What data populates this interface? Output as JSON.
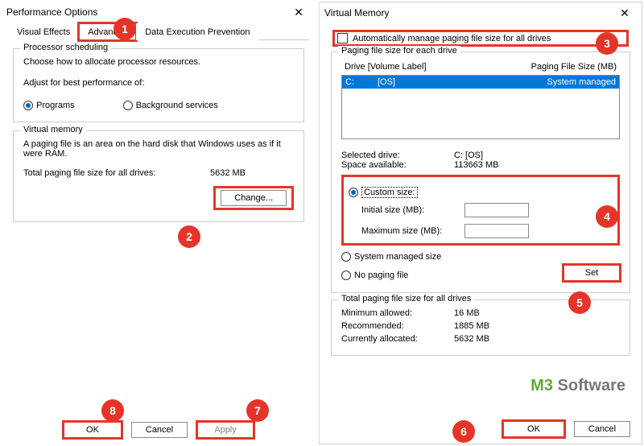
{
  "left": {
    "title": "Performance Options",
    "tabs": {
      "visual": "Visual Effects",
      "advanced": "Advanced",
      "dep": "Data Execution Prevention"
    },
    "processor": {
      "group": "Processor scheduling",
      "desc": "Choose how to allocate processor resources.",
      "adjust": "Adjust for best performance of:",
      "programs": "Programs",
      "background": "Background services"
    },
    "vm": {
      "group": "Virtual memory",
      "desc": "A paging file is an area on the hard disk that Windows uses as if it were RAM.",
      "total_label": "Total paging file size for all drives:",
      "total_value": "5632 MB",
      "change": "Change..."
    },
    "buttons": {
      "ok": "OK",
      "cancel": "Cancel",
      "apply": "Apply"
    }
  },
  "right": {
    "title": "Virtual Memory",
    "auto_label": "Automatically manage paging file size for all drives",
    "group1": "Paging file size for each drive",
    "col_drive": "Drive  [Volume Label]",
    "col_size": "Paging File Size (MB)",
    "row_drive": "C:",
    "row_vol": "[OS]",
    "row_size": "System managed",
    "selected_label": "Selected drive:",
    "selected_value": "C:  [OS]",
    "space_label": "Space available:",
    "space_value": "113663 MB",
    "custom": "Custom size:",
    "initial": "Initial size (MB):",
    "maximum": "Maximum size (MB):",
    "system_managed": "System managed size",
    "no_paging": "No paging file",
    "set": "Set",
    "group2": "Total paging file size for all drives",
    "min_label": "Minimum allowed:",
    "min_value": "16 MB",
    "rec_label": "Recommended:",
    "rec_value": "1885 MB",
    "cur_label": "Currently allocated:",
    "cur_value": "5632 MB",
    "ok": "OK",
    "cancel": "Cancel"
  },
  "badges": {
    "b1": "1",
    "b2": "2",
    "b3": "3",
    "b4": "4",
    "b5": "5",
    "b6": "6",
    "b7": "7",
    "b8": "8"
  },
  "watermark": {
    "m3": "M3",
    "soft": "Software"
  }
}
